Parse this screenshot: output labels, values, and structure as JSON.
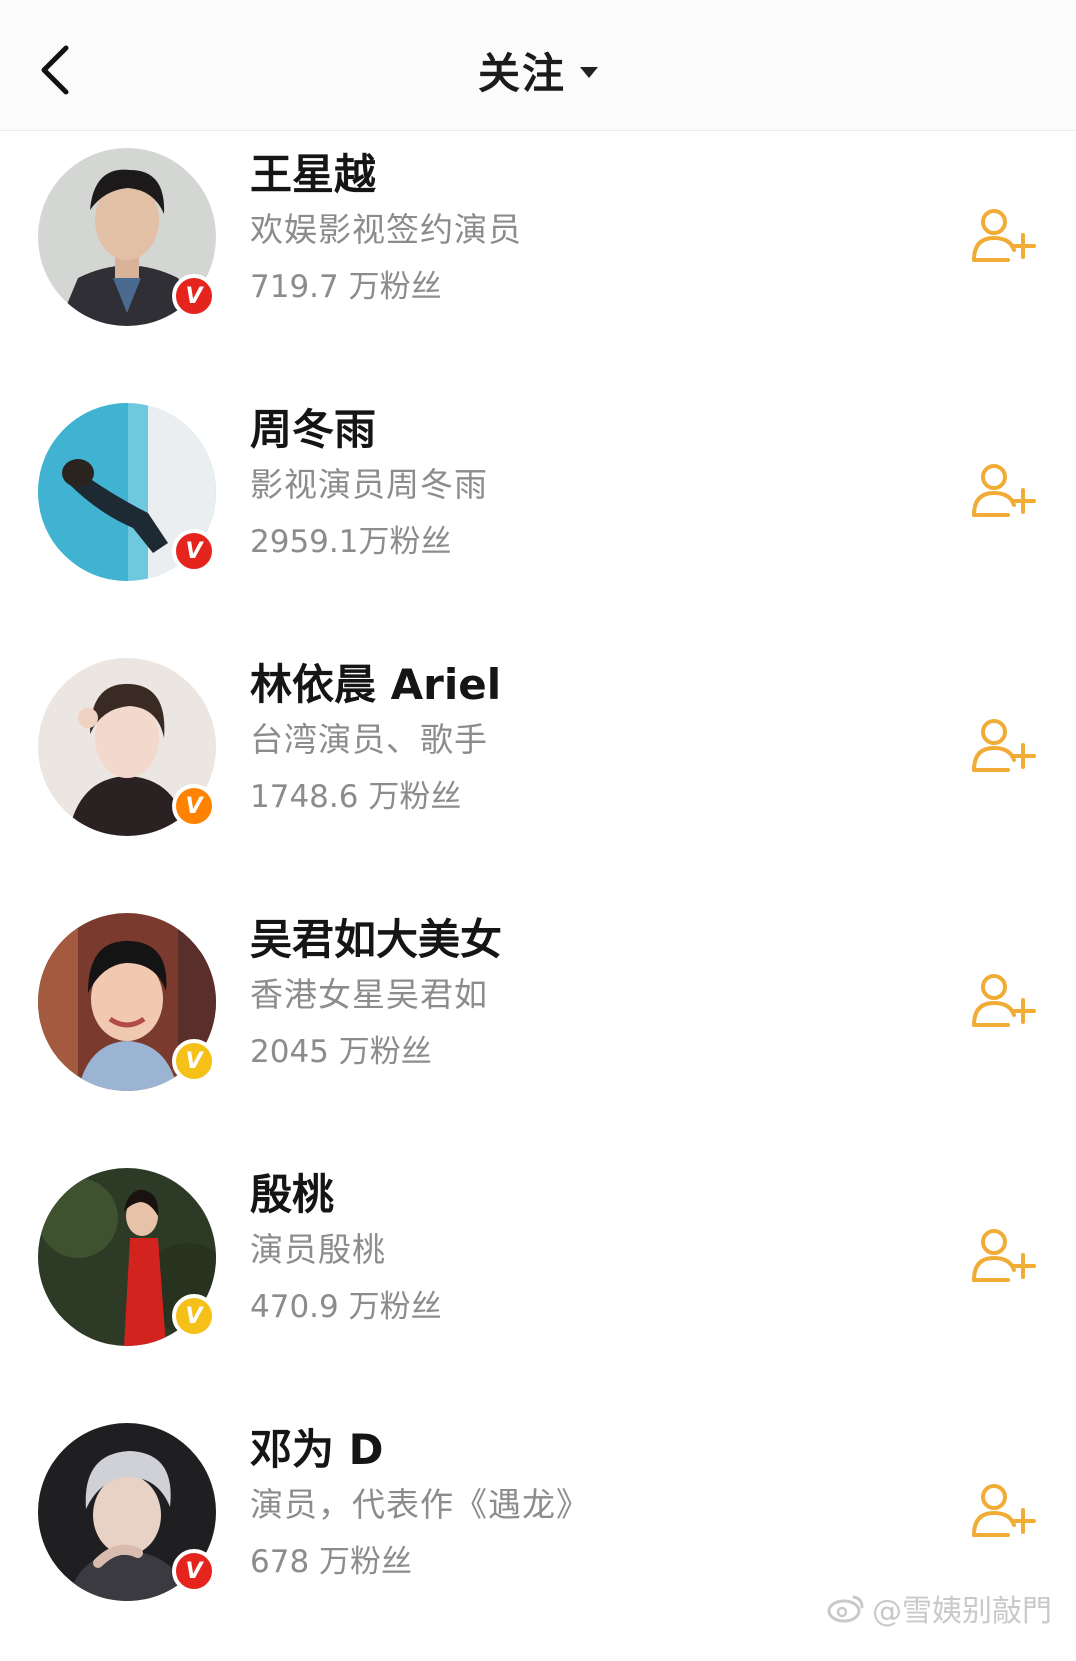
{
  "header": {
    "title": "关注",
    "back_icon": "chevron-left-icon",
    "dropdown_icon": "caret-down-icon"
  },
  "colors": {
    "accent": "#f0ac35",
    "verified_red": "#e5241d",
    "verified_orange": "#ff8200",
    "verified_yellow": "#f5c018"
  },
  "users": [
    {
      "name": "王星越",
      "desc": "欢娱影视签约演员",
      "fans": "719.7 万粉丝",
      "badge": "V",
      "badge_color": "#e5241d"
    },
    {
      "name": "周冬雨",
      "desc": "影视演员周冬雨",
      "fans": "2959.1万粉丝",
      "badge": "V",
      "badge_color": "#e5241d"
    },
    {
      "name": "林依晨 Ariel",
      "desc": "台湾演员、歌手",
      "fans": "1748.6 万粉丝",
      "badge": "V",
      "badge_color": "#ff8200"
    },
    {
      "name": "吴君如大美女",
      "desc": "香港女星吴君如",
      "fans": "2045 万粉丝",
      "badge": "V",
      "badge_color": "#f5c018"
    },
    {
      "name": "殷桃",
      "desc": "演员殷桃",
      "fans": "470.9 万粉丝",
      "badge": "V",
      "badge_color": "#f5c018"
    },
    {
      "name": "邓为 D",
      "desc": "演员，代表作《遇龙》",
      "fans": "678 万粉丝",
      "badge": "V",
      "badge_color": "#e5241d"
    }
  ],
  "watermark": {
    "text": "@雪姨别敲門",
    "icon": "weibo-logo-icon"
  }
}
